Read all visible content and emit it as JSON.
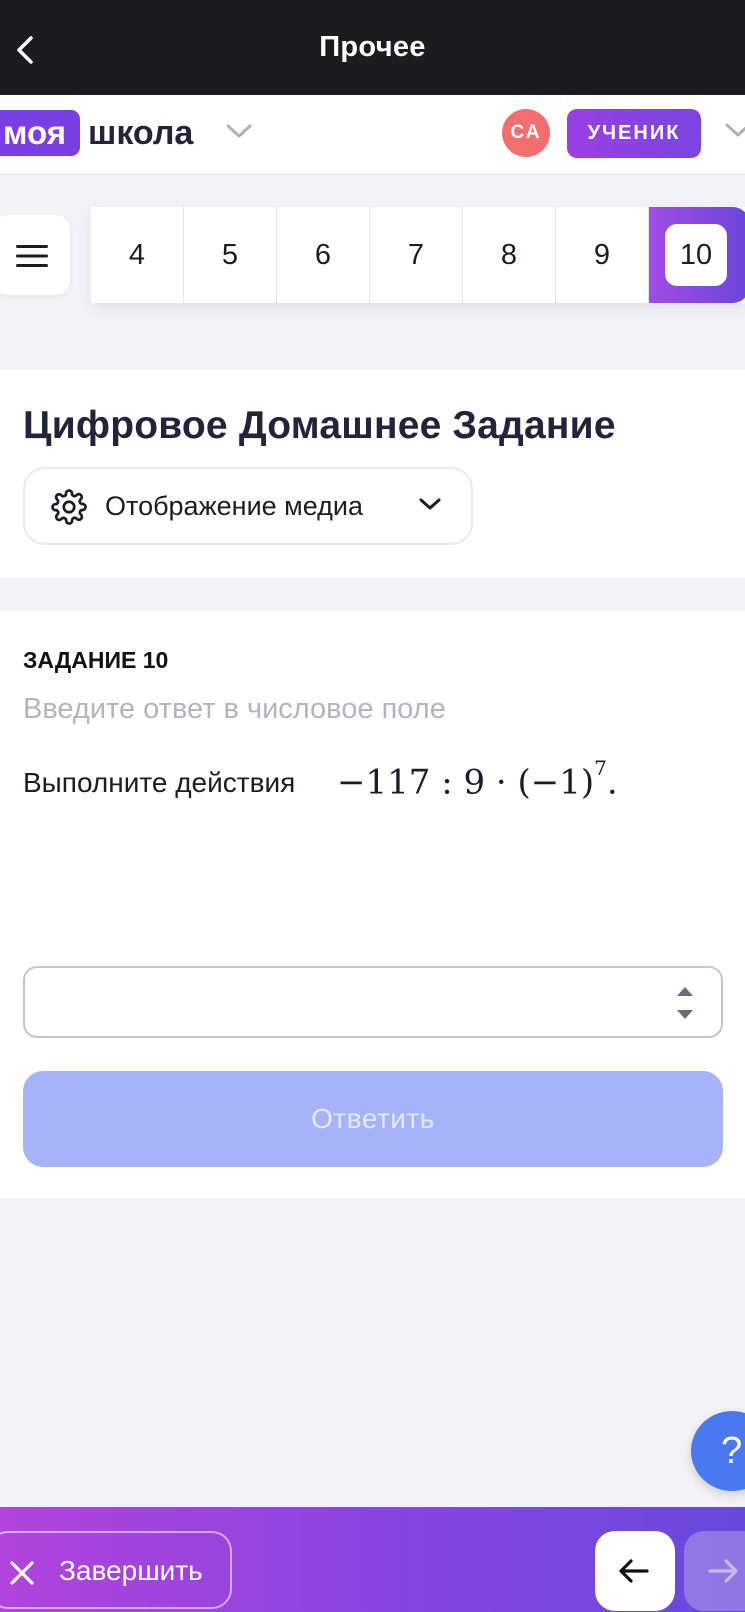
{
  "header": {
    "title": "Прочее",
    "back_icon": "chevron-left-icon"
  },
  "brand": {
    "logo_badge": "моя",
    "logo_text": "школа",
    "avatar_initials": "СА",
    "role": "УЧЕНИК",
    "colors": {
      "logo_badge": "#7a3fe0",
      "avatar": "#f36f6f",
      "role_badge": "#8a45e0"
    }
  },
  "task_nav": {
    "menu_icon": "hamburger-icon",
    "tabs": [
      "4",
      "5",
      "6",
      "7",
      "8",
      "9"
    ],
    "active_tab": "10"
  },
  "assignment": {
    "title": "Цифровое Домашнее Задание",
    "media_select": {
      "label": "Отображение медиа",
      "icon": "gear-icon"
    }
  },
  "task": {
    "label": "ЗАДАНИЕ 10",
    "hint": "Введите ответ в числовое поле",
    "question": "Выполните действия",
    "expression": "−117 : 9 · (−1)",
    "exponent": "7",
    "expression_end": ".",
    "answer_value": "",
    "submit_label": "Ответить",
    "submit_color": "#a5b4f8"
  },
  "help": {
    "label": "?"
  },
  "footer": {
    "finish_label": "Завершить",
    "finish_icon": "close-icon",
    "prev_icon": "arrow-left-icon",
    "next_icon": "arrow-right-icon"
  }
}
